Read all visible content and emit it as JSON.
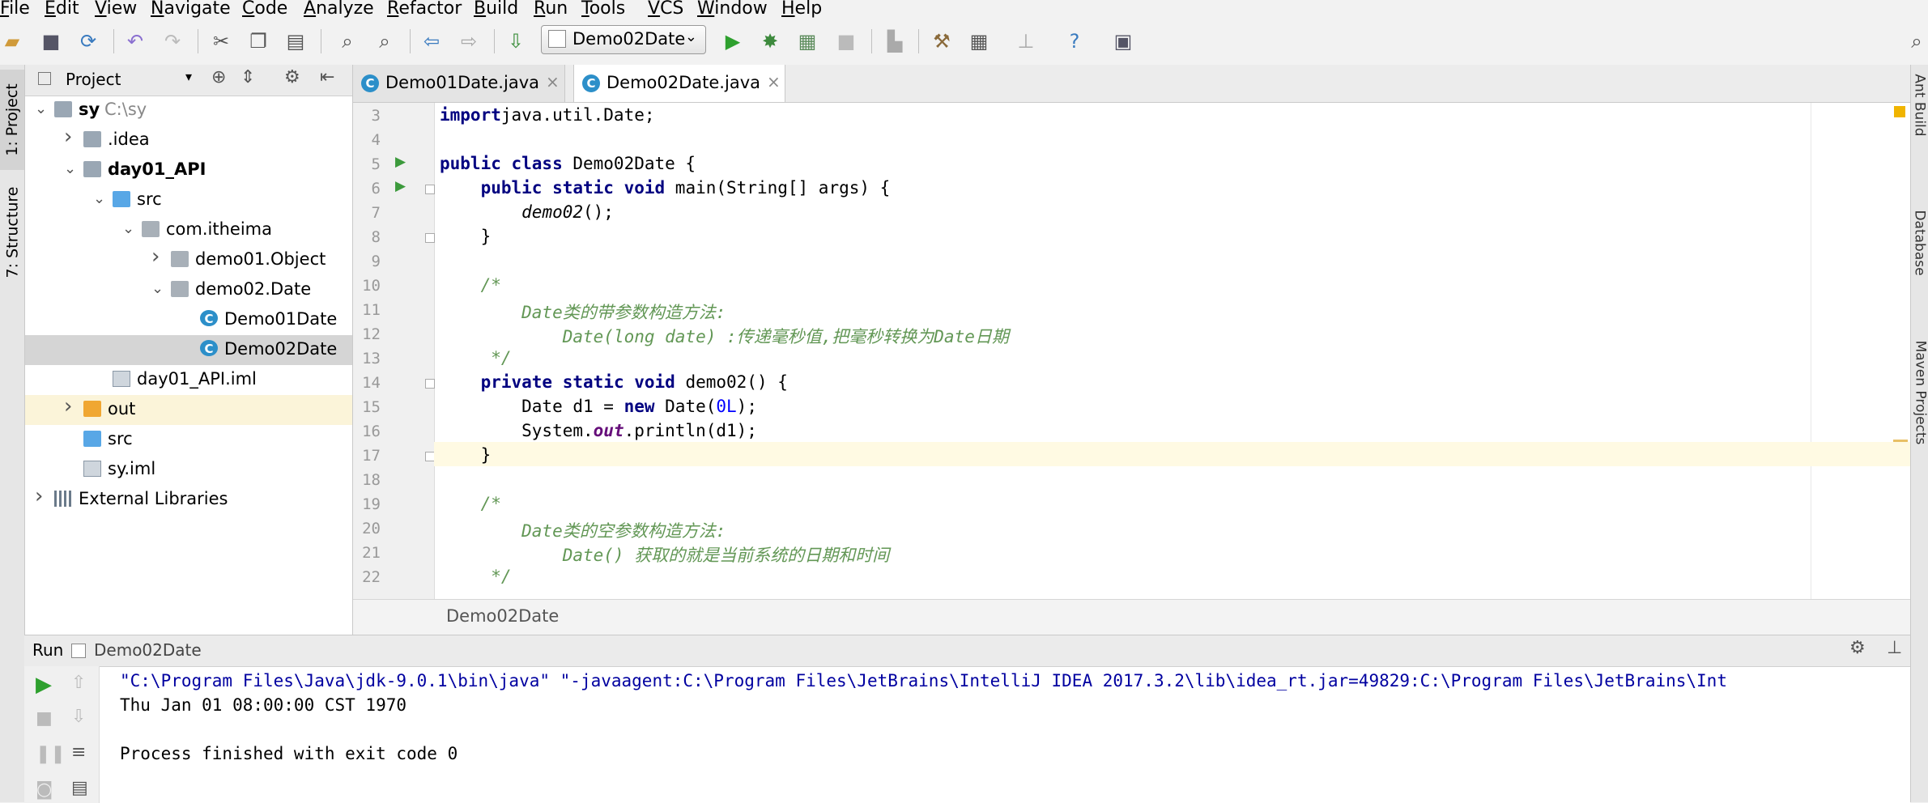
{
  "menu": [
    "File",
    "Edit",
    "View",
    "Navigate",
    "Code",
    "Analyze",
    "Refactor",
    "Build",
    "Run",
    "Tools",
    "VCS",
    "Window",
    "Help"
  ],
  "toolbar": {
    "run_config": "Demo02Date",
    "icons": [
      "open-folder-icon",
      "save-icon",
      "sync-icon",
      "undo-icon",
      "redo-icon",
      "cut-icon",
      "copy-icon",
      "paste-icon",
      "find-icon",
      "replace-icon",
      "back-icon",
      "forward-icon",
      "build-icon",
      "run-icon",
      "debug-icon",
      "coverage-icon",
      "stop-icon",
      "vcs-icon",
      "settings-icon",
      "project-structure-icon",
      "sdk-icon",
      "help-icon",
      "jira-icon",
      "search-icon"
    ]
  },
  "left_stripe": {
    "project_tab": "1: Project",
    "structure_tab": "7: Structure"
  },
  "right_stripe": {
    "ant_tab": "Ant Build",
    "database_tab": "Database",
    "maven_tab": "Maven Projects"
  },
  "project_panel": {
    "title": "Project",
    "tree": [
      {
        "label": "sy",
        "path": "C:\\sy",
        "indent": 0,
        "icon": "folder",
        "expanded": true,
        "bold": true
      },
      {
        "label": ".idea",
        "indent": 1,
        "icon": "folder",
        "expanded": false
      },
      {
        "label": "day01_API",
        "indent": 1,
        "icon": "folder",
        "expanded": true,
        "bold": true
      },
      {
        "label": "src",
        "indent": 2,
        "icon": "folder-blue",
        "expanded": true
      },
      {
        "label": "com.itheima",
        "indent": 3,
        "icon": "package",
        "expanded": true
      },
      {
        "label": "demo01.Object",
        "indent": 4,
        "icon": "package",
        "expanded": false
      },
      {
        "label": "demo02.Date",
        "indent": 4,
        "icon": "package",
        "expanded": true
      },
      {
        "label": "Demo01Date",
        "indent": 5,
        "icon": "class"
      },
      {
        "label": "Demo02Date",
        "indent": 5,
        "icon": "class",
        "selected": true
      },
      {
        "label": "day01_API.iml",
        "indent": 2,
        "icon": "file"
      },
      {
        "label": "out",
        "indent": 1,
        "icon": "folder-orange",
        "expanded": false
      },
      {
        "label": "src",
        "indent": 1,
        "icon": "folder-blue"
      },
      {
        "label": "sy.iml",
        "indent": 1,
        "icon": "file"
      },
      {
        "label": "External Libraries",
        "indent": 0,
        "icon": "library",
        "expanded": false
      }
    ]
  },
  "editor": {
    "tabs": [
      {
        "label": "Demo01Date.java",
        "active": false
      },
      {
        "label": "Demo02Date.java",
        "active": true
      }
    ],
    "lines": [
      {
        "n": "3",
        "tokens": [
          [
            "kw",
            "import"
          ],
          [
            "",
            "java.util.Date;"
          ]
        ]
      },
      {
        "n": "4",
        "tokens": []
      },
      {
        "n": "5",
        "run": true,
        "tokens": [
          [
            "kw",
            "public class"
          ],
          [
            "",
            " Demo02Date {"
          ]
        ]
      },
      {
        "n": "6",
        "run": true,
        "fold": true,
        "tokens": [
          [
            "",
            "    "
          ],
          [
            "kw",
            "public static void"
          ],
          [
            "",
            " main(String[] args) {"
          ]
        ]
      },
      {
        "n": "7",
        "tokens": [
          [
            "",
            "        "
          ],
          [
            "it",
            "demo02"
          ],
          [
            "",
            "();"
          ]
        ]
      },
      {
        "n": "8",
        "fold": true,
        "tokens": [
          [
            "",
            "    }"
          ]
        ]
      },
      {
        "n": "9",
        "tokens": []
      },
      {
        "n": "10",
        "tokens": [
          [
            "cm",
            "    /*"
          ]
        ]
      },
      {
        "n": "11",
        "tokens": [
          [
            "cm",
            "        Date类的带参数构造方法:"
          ]
        ]
      },
      {
        "n": "12",
        "tokens": [
          [
            "cm",
            "            Date(long date) :传递毫秒值,把毫秒转换为Date日期"
          ]
        ]
      },
      {
        "n": "13",
        "tokens": [
          [
            "cm",
            "     */"
          ]
        ]
      },
      {
        "n": "14",
        "fold": true,
        "tokens": [
          [
            "",
            "    "
          ],
          [
            "kw",
            "private static void"
          ],
          [
            "",
            " demo02() {"
          ]
        ]
      },
      {
        "n": "15",
        "tokens": [
          [
            "",
            "        Date d1 = "
          ],
          [
            "kw",
            "new"
          ],
          [
            "",
            " Date("
          ],
          [
            "num",
            "0L"
          ],
          [
            "",
            ");"
          ]
        ]
      },
      {
        "n": "16",
        "tokens": [
          [
            "",
            "        System."
          ],
          [
            "sf",
            "out"
          ],
          [
            "",
            ".println(d1);"
          ]
        ]
      },
      {
        "n": "17",
        "fold": true,
        "caret": true,
        "tokens": [
          [
            "",
            "    }"
          ]
        ]
      },
      {
        "n": "18",
        "tokens": []
      },
      {
        "n": "19",
        "tokens": [
          [
            "cm",
            "    /*"
          ]
        ]
      },
      {
        "n": "20",
        "tokens": [
          [
            "cm",
            "        Date类的空参数构造方法:"
          ]
        ]
      },
      {
        "n": "21",
        "tokens": [
          [
            "cm",
            "            Date() 获取的就是当前系统的日期和时间"
          ]
        ]
      },
      {
        "n": "22",
        "tokens": [
          [
            "cm",
            "     */"
          ]
        ]
      }
    ],
    "breadcrumb": "Demo02Date"
  },
  "run_panel": {
    "title": "Run",
    "config": "Demo02Date",
    "output": [
      "\"C:\\Program Files\\Java\\jdk-9.0.1\\bin\\java\" \"-javaagent:C:\\Program Files\\JetBrains\\IntelliJ IDEA 2017.3.2\\lib\\idea_rt.jar=49829:C:\\Program Files\\JetBrains\\Int",
      "Thu Jan 01 08:00:00 CST 1970",
      "",
      "Process finished with exit code 0"
    ]
  }
}
